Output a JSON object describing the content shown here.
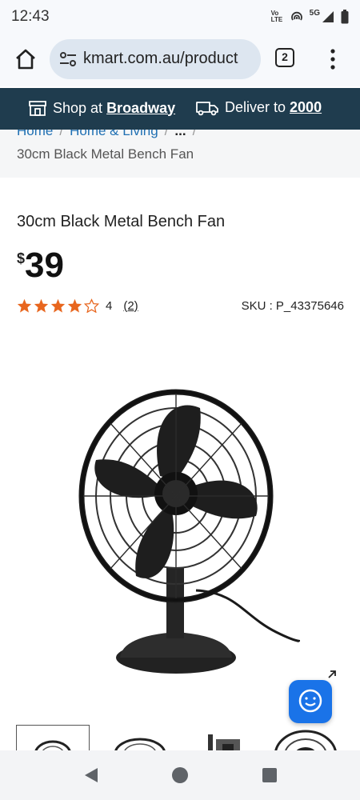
{
  "status_bar": {
    "time": "12:43",
    "network": "5G",
    "volte": "Vo LTE"
  },
  "browser": {
    "url": "kmart.com.au/product",
    "tab_count": "2"
  },
  "store_bar": {
    "shop_prefix": "Shop at ",
    "store_name": "Broadway",
    "deliver_prefix": "Deliver to ",
    "postcode": "2000"
  },
  "breadcrumb": {
    "items": [
      "Home",
      "Home & Living",
      "..."
    ],
    "separator": "/",
    "current": "30cm Black Metal Bench Fan"
  },
  "product": {
    "title": "30cm Black Metal Bench Fan",
    "price_currency": "$",
    "price": "39",
    "rating": 4,
    "rating_label": "4",
    "review_count": "(2)",
    "sku": "SKU : P_43375646"
  },
  "colors": {
    "accent_orange": "#e8661e",
    "store_bar": "#1f3c4e",
    "chat_blue": "#1a73e8",
    "link_blue": "#1f6fb2"
  },
  "icons": {
    "home": "home-icon",
    "tune": "tune-icon",
    "tabs": "tabs-icon",
    "menu": "more-vert-icon",
    "store": "store-icon",
    "delivery": "truck-icon",
    "star": "star-icon",
    "expand": "expand-icon",
    "chat": "chat-icon",
    "back": "back-icon",
    "home_nav": "home-nav-icon",
    "recents": "recents-icon"
  }
}
